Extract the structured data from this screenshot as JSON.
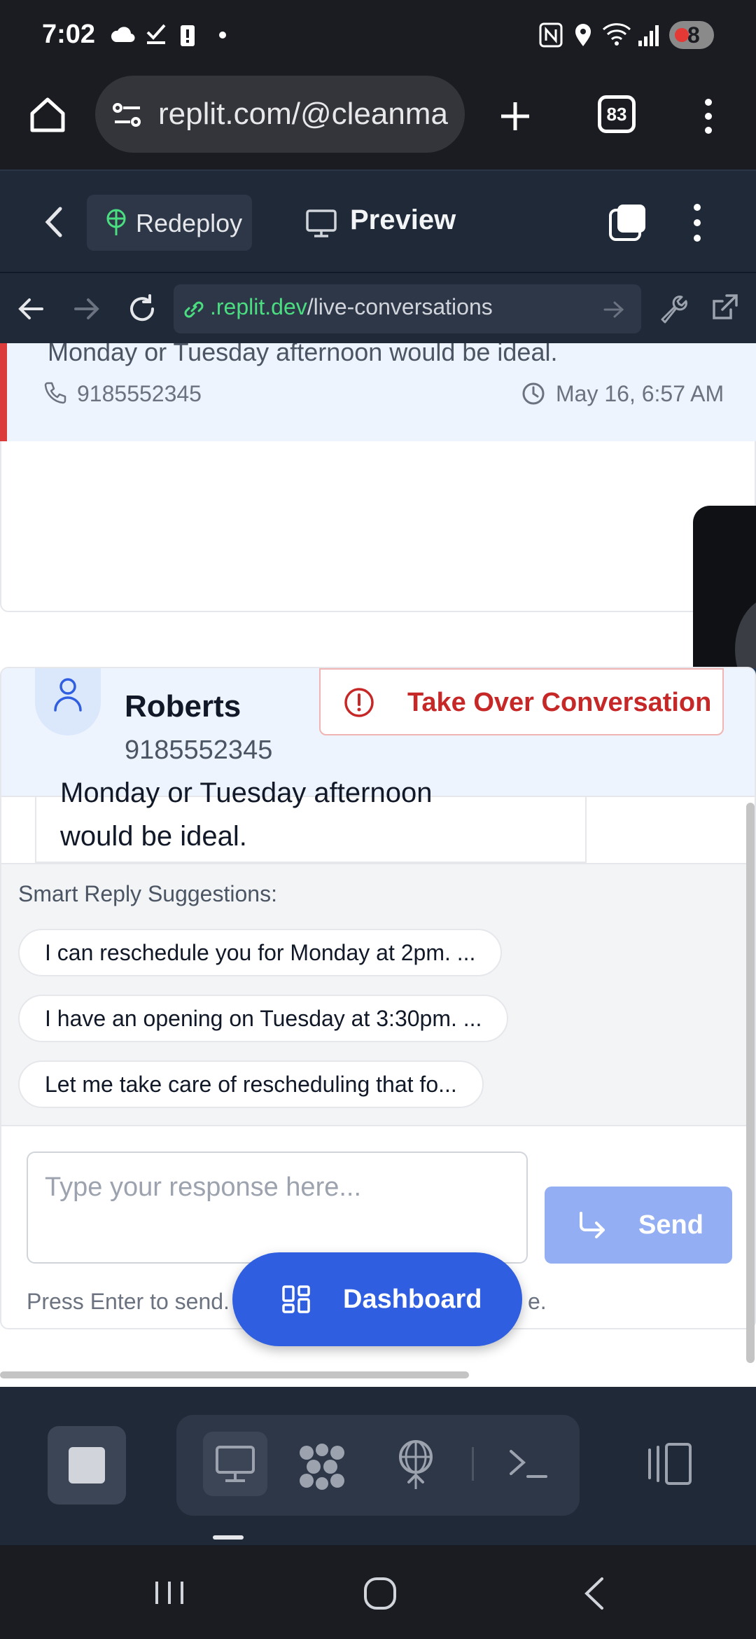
{
  "status_bar": {
    "time": "7:02",
    "battery_level": "8"
  },
  "browser": {
    "url": "replit.com/@cleanma",
    "tab_count": "83"
  },
  "replit_toolbar": {
    "redeploy_label": "Redeploy",
    "preview_label": "Preview"
  },
  "webview_nav": {
    "domain_part": ".replit.dev",
    "path_part": "/live-conversations"
  },
  "previous_message": {
    "text": "Monday or Tuesday afternoon would be ideal.",
    "phone": "9185552345",
    "timestamp": "May 16, 6:57 AM"
  },
  "conversation": {
    "customer_name": "Roberts",
    "customer_phone": "9185552345",
    "takeover_label": "Take Over Conversation",
    "message_line1": "Monday or Tuesday afternoon",
    "message_line2": "would be ideal.",
    "smart_reply_title": "Smart Reply Suggestions:",
    "suggestions": [
      "I can reschedule you for Monday at 2pm. ...",
      "I have an opening on Tuesday at 3:30pm. ...",
      "Let me take care of rescheduling that fo..."
    ],
    "response_placeholder": "Type your response here...",
    "send_label": "Send",
    "hint_left": "Press Enter to send.",
    "hint_right": "e."
  },
  "floating_action": {
    "dashboard_label": "Dashboard"
  },
  "colors": {
    "accent_blue": "#2f5ee0",
    "danger_red": "#c62828",
    "link_green": "#4ade80",
    "toolbar_dark": "#1f2937"
  }
}
